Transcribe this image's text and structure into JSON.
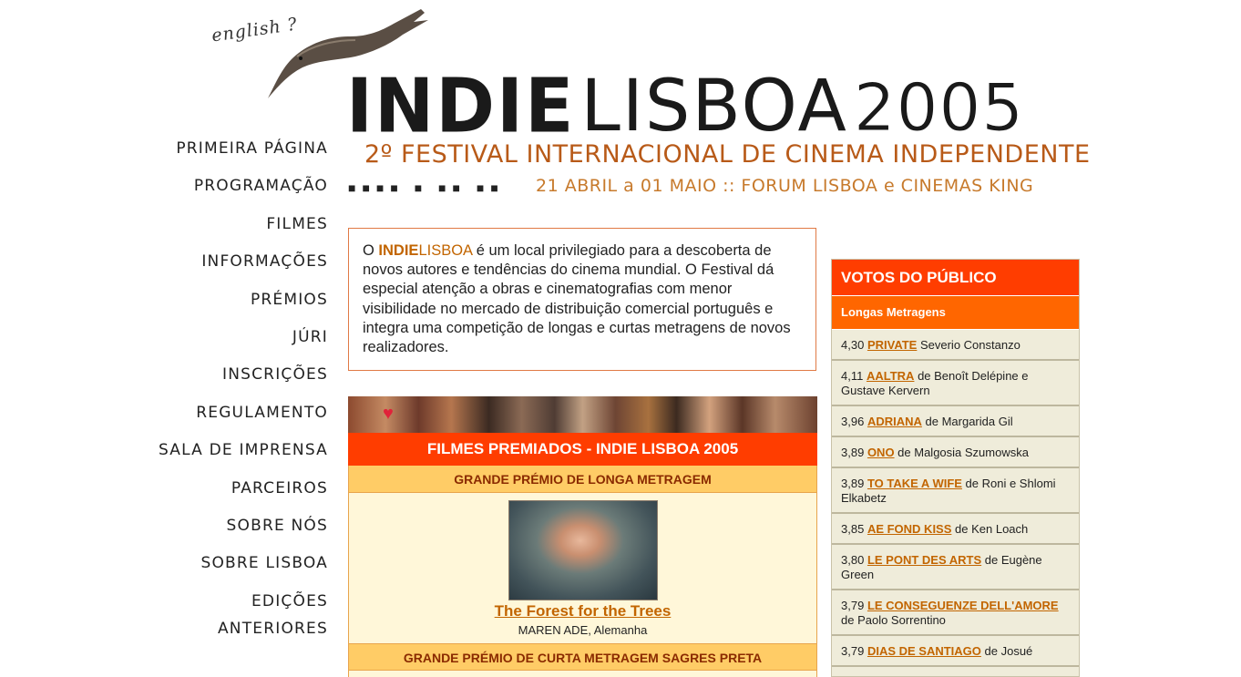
{
  "header": {
    "language_link": "english ?",
    "logo": {
      "part1": "INDIE",
      "part2": "LISBOA",
      "part3": "2005"
    },
    "tagline": "2º FESTIVAL INTERNACIONAL DE CINEMA INDEPENDENTE",
    "dots": "■■■■ ■ ■■ ■■",
    "dates": "21 ABRIL a 01 MAIO :: FORUM LISBOA e CINEMAS KING"
  },
  "nav": [
    "PRIMEIRA PÁGINA",
    "PROGRAMAÇÃO",
    "FILMES",
    "INFORMAÇÕES",
    "PRÉMIOS",
    "JÚRI",
    "INSCRIÇÕES",
    "REGULAMENTO",
    "SALA DE IMPRENSA",
    "PARCEIROS",
    "SOBRE NÓS",
    "SOBRE LISBOA",
    "EDIÇÕES ANTERIORES"
  ],
  "intro": {
    "prefix": "O ",
    "brand_bold": "INDIE",
    "brand_light": "LISBOA",
    "text": " é um local privilegiado para a descoberta de novos autores e tendências do cinema mundial. O Festival dá especial atenção a obras e cinematografias com menor visibilidade no mercado de distribuição comercial português e integra uma competição de longas e curtas metragens de novos realizadores."
  },
  "prizes": {
    "heading": "FILMES PREMIADOS - INDIE LISBOA 2005",
    "sections": [
      {
        "title": "GRANDE PRÉMIO DE LONGA METRAGEM",
        "film": "The Forest for the Trees",
        "director": "MAREN ADE",
        "country": "Alemanha"
      },
      {
        "title": "GRANDE PRÉMIO DE CURTA METRAGEM SAGRES PRETA"
      }
    ]
  },
  "votes": {
    "title": "VOTOS DO PÚBLICO",
    "category": "Longas Metragens",
    "items": [
      {
        "score": "4,30",
        "film": "PRIVATE",
        "rest": " Severio Constanzo"
      },
      {
        "score": "4,11",
        "film": "AALTRA",
        "rest": " de Benoît Delépine e Gustave Kervern"
      },
      {
        "score": "3,96",
        "film": "ADRIANA",
        "rest": " de Margarida Gil"
      },
      {
        "score": "3,89",
        "film": "ONO",
        "rest": " de Malgosia Szumowska"
      },
      {
        "score": "3,89",
        "film": "TO TAKE A WIFE",
        "rest": " de Roni e Shlomi Elkabetz"
      },
      {
        "score": "3,85",
        "film": "AE FOND KISS",
        "rest": " de Ken Loach"
      },
      {
        "score": "3,80",
        "film": "LE PONT DES ARTS",
        "rest": " de Eugène Green"
      },
      {
        "score": "3,79",
        "film": "LE CONSEGUENZE DELL'AMORE",
        "rest": " de Paolo Sorrentino"
      },
      {
        "score": "3,79",
        "film": "DIAS DE SANTIAGO",
        "rest": " de Josué"
      }
    ]
  }
}
